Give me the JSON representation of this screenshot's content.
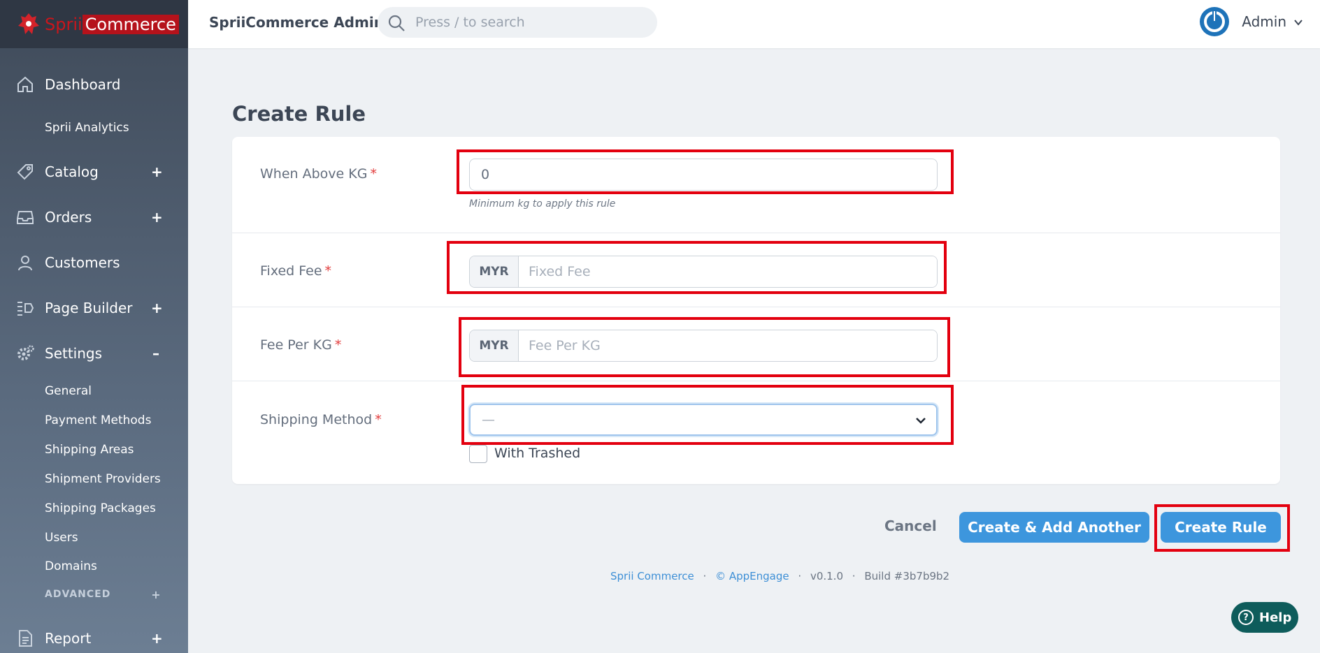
{
  "brand": {
    "part1": "Sprii",
    "part2": "Commerce"
  },
  "topbar": {
    "title": "SpriiCommerce Admin",
    "search_placeholder": "Press / to search",
    "user_name": "Admin"
  },
  "sidebar": {
    "dashboard": "Dashboard",
    "analytics": "Sprii Analytics",
    "catalog": "Catalog",
    "orders": "Orders",
    "customers": "Customers",
    "page_builder": "Page Builder",
    "settings": "Settings",
    "settings_items": [
      "General",
      "Payment Methods",
      "Shipping Areas",
      "Shipment Providers",
      "Shipping Packages",
      "Users",
      "Domains"
    ],
    "advanced": "ADVANCED",
    "report": "Report",
    "expand_symbol": "+",
    "collapse_symbol": "–"
  },
  "page": {
    "title": "Create Rule"
  },
  "form": {
    "when_above_kg": {
      "label": "When Above KG",
      "value": "0",
      "help": "Minimum kg to apply this rule"
    },
    "fixed_fee": {
      "label": "Fixed Fee",
      "currency": "MYR",
      "placeholder": "Fixed Fee"
    },
    "fee_per_kg": {
      "label": "Fee Per KG",
      "currency": "MYR",
      "placeholder": "Fee Per KG"
    },
    "shipping_method": {
      "label": "Shipping Method",
      "selected": "—",
      "with_trashed_label": "With Trashed"
    },
    "required_marker": "*"
  },
  "actions": {
    "cancel": "Cancel",
    "create_add_another": "Create & Add Another",
    "create": "Create Rule"
  },
  "footer": {
    "brand": "Sprii Commerce",
    "copyright": "© AppEngage",
    "version": "v0.1.0",
    "build": "Build #3b7b9b2",
    "separator": "·"
  },
  "help": {
    "label": "Help",
    "icon_glyph": "?"
  },
  "colors": {
    "primary": "#3d96dd",
    "highlight": "#e3000f",
    "sidebar": "#4a5668",
    "help": "#0e5c5b"
  }
}
